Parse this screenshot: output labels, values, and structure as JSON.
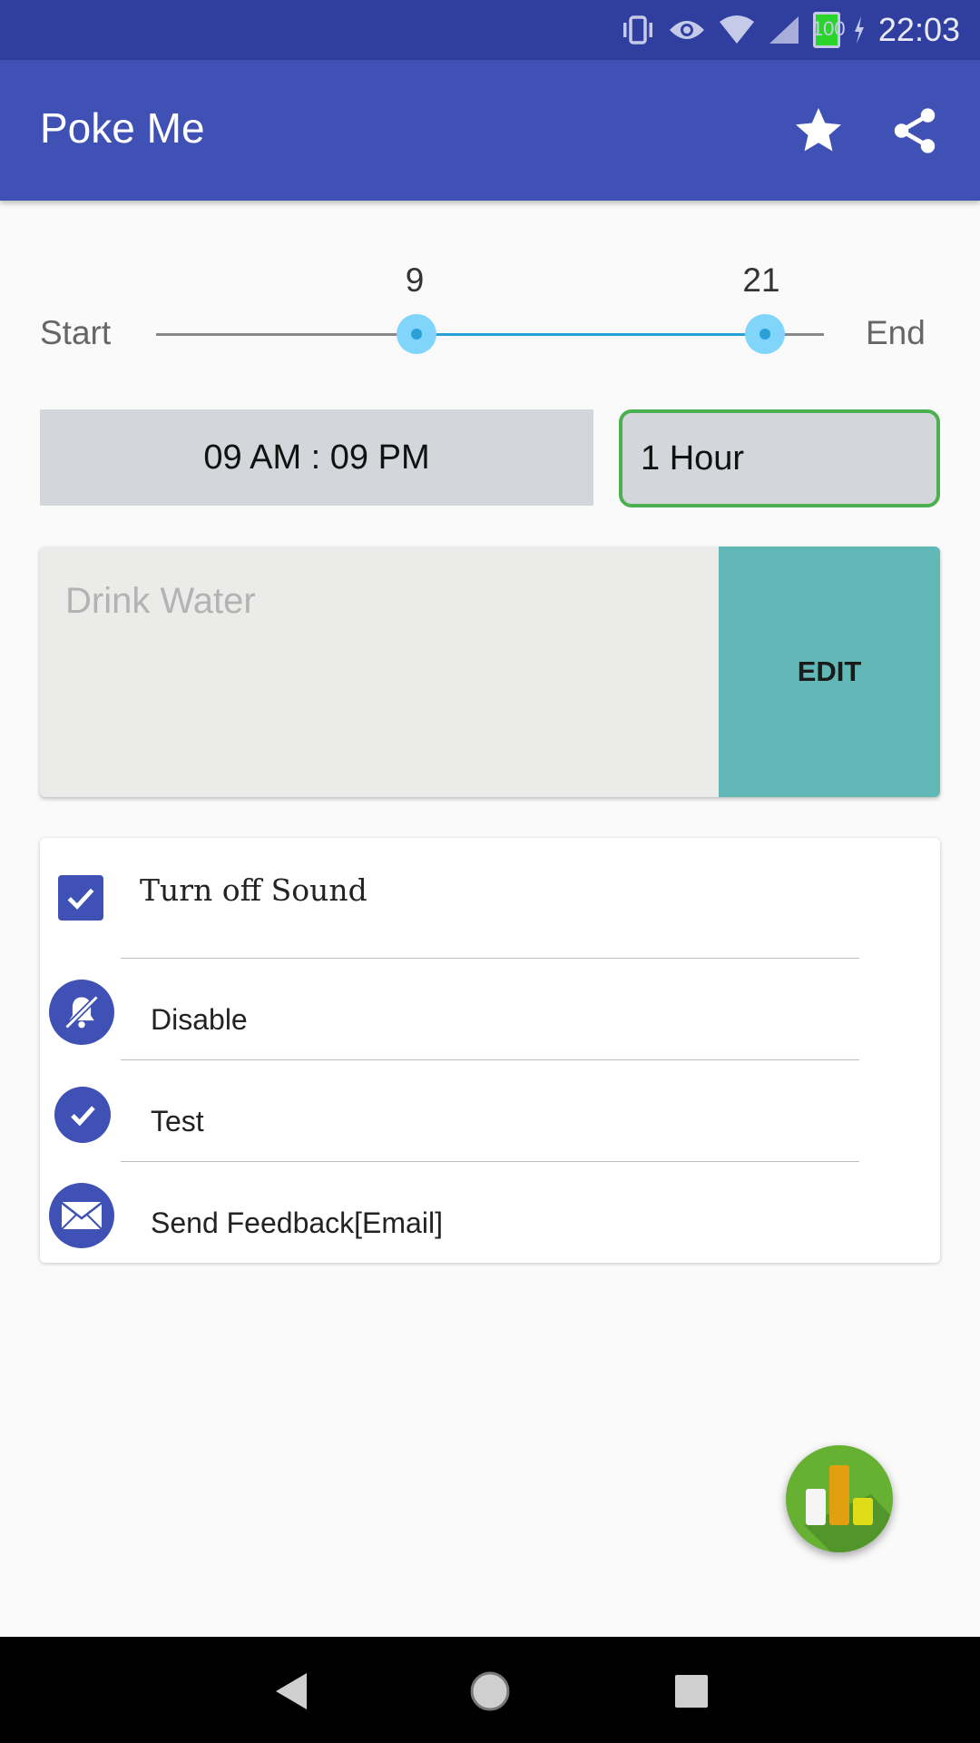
{
  "status_bar": {
    "time": "22:03",
    "battery": "100"
  },
  "app_bar": {
    "title": "Poke Me"
  },
  "slider": {
    "start_label": "Start",
    "end_label": "End",
    "start_value": "9",
    "end_value": "21"
  },
  "time_range": {
    "value": "09 AM : 09 PM"
  },
  "interval": {
    "value": "1 Hour"
  },
  "message": {
    "placeholder": "Drink Water",
    "edit_label": "EDIT"
  },
  "options": {
    "sound_checkbox": {
      "label": "Turn off Sound",
      "checked": true
    },
    "items": [
      {
        "label": "Disable",
        "icon": "notifications-off-icon"
      },
      {
        "label": "Test",
        "icon": "check-circle-icon"
      },
      {
        "label": "Send Feedback[Email]",
        "icon": "email-icon"
      }
    ]
  },
  "colors": {
    "primary": "#3f51b5",
    "primary_dark": "#303f9f",
    "accent_teal": "#62b8b7",
    "slider": "#29a0d8",
    "interval_border": "#4caf50"
  }
}
